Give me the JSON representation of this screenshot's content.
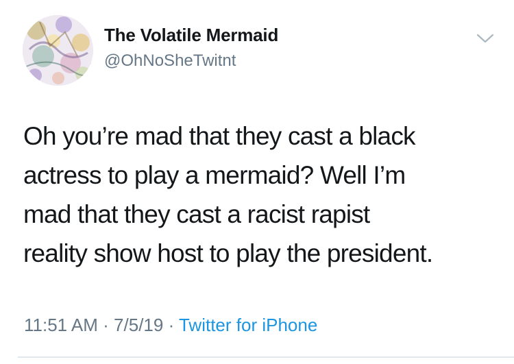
{
  "user": {
    "display_name": "The Volatile Mermaid",
    "handle": "@OhNoSheTwitnt"
  },
  "tweet": {
    "lines": [
      "Oh you’re mad that they cast a black",
      "actress to play a mermaid? Well I’m",
      "mad that they cast a racist rapist",
      "reality show host to play the president."
    ]
  },
  "meta": {
    "time": "11:51 AM",
    "sep1": " · ",
    "date": "7/5/19",
    "sep2": " · ",
    "source": "Twitter for iPhone"
  },
  "icons": {
    "avatar": "profile-avatar",
    "menu": "chevron-down-icon"
  },
  "colors": {
    "text": "#14171a",
    "secondary": "#657786",
    "link": "#1b95e0"
  }
}
